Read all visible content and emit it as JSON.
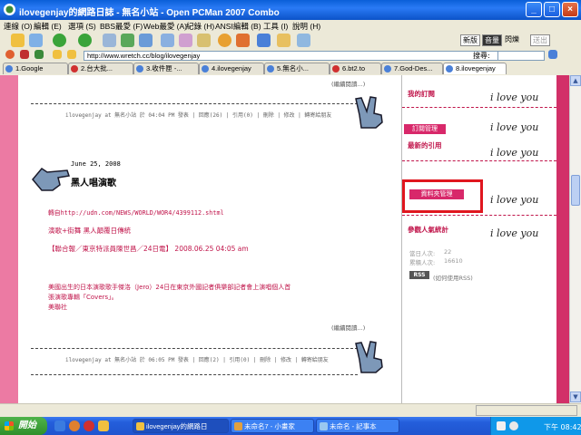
{
  "window": {
    "title": "ilovegenjay的網路日誌 - 無名小站 - Open PCMan 2007 Combo",
    "minimize": "_",
    "maximize": "□",
    "close": "×"
  },
  "menu": [
    "連線 (O)",
    "編輯 (E)",
    "選項 (S)",
    "BBS最愛 (F)",
    "Web最愛 (A)",
    "紀錄 (H)",
    "ANSI編輯 (B)",
    "工具 (I)",
    "說明 (H)"
  ],
  "toolbar": {
    "btn_new": "新版",
    "btn_sound": "音量",
    "btn_mode": "閃爍",
    "btn_send": "送出",
    "search_label": "搜尋:"
  },
  "address": {
    "url": "http://www.wretch.cc/blog/ilovegenjay"
  },
  "tabs": [
    {
      "label": "1.Google"
    },
    {
      "label": "2.台大批..."
    },
    {
      "label": "3.收件匣 -..."
    },
    {
      "label": "4.ilovegenjay"
    },
    {
      "label": "5.無名小..."
    },
    {
      "label": "6.bt2.to"
    },
    {
      "label": "7.God-Des..."
    },
    {
      "label": "8.ilovegenjay"
    }
  ],
  "blog": {
    "read_more": "(繼續閱讀...)",
    "footer1": "ilovegenjay at 無名小站 於 04:04 PM 發表 | 回應(26) | 引用(0) | 刪除 | 修改 | 轉寄給朋友",
    "date": "June 25, 2008",
    "post_title": "黑人唱演歌",
    "source_link": "轉自http://udn.com/NEWS/WORLD/WOR4/4399112.shtml",
    "subheading": "演歌+街舞 黑人顛覆日傳統",
    "byline": "【聯合報／東京特派員陳世昌／24日電】 2008.06.25 04:05 am",
    "body_line1": "美國出生的日本演歌歌手傑洛（Jero）24日在東京外國記者俱樂部記者會上演唱個人首",
    "body_line2": "張演歌專輯「Covers」。",
    "body_line3": "美聯社",
    "read_more2": "(繼續閱讀...)",
    "footer2": "ilovegenjay at 無名小站 於 06:05 PM 發表 | 回應(2) | 引用(0) | 刪除 | 修改 | 轉寄給朋友"
  },
  "sidebar": {
    "subscribe_title": "我的訂閱",
    "subscribe_manage": "訂閱管理",
    "latest_ref": "最新的引用",
    "folder_manage": "資料夾管理",
    "visitor_title": "參觀人氣統計",
    "today_label": "當日人次:",
    "today_value": "22",
    "total_label": "累積人次:",
    "total_value": "16610",
    "rss_badge": "RSS",
    "rss_text": "(如何使用RSS)",
    "love_text": "i love you"
  },
  "taskbar": {
    "start": "開始",
    "tasks": [
      "ilovegenjay的網路日",
      "未命名7 - 小畫家",
      "未命名 - 記事本"
    ],
    "clock": "下午 08:42"
  }
}
